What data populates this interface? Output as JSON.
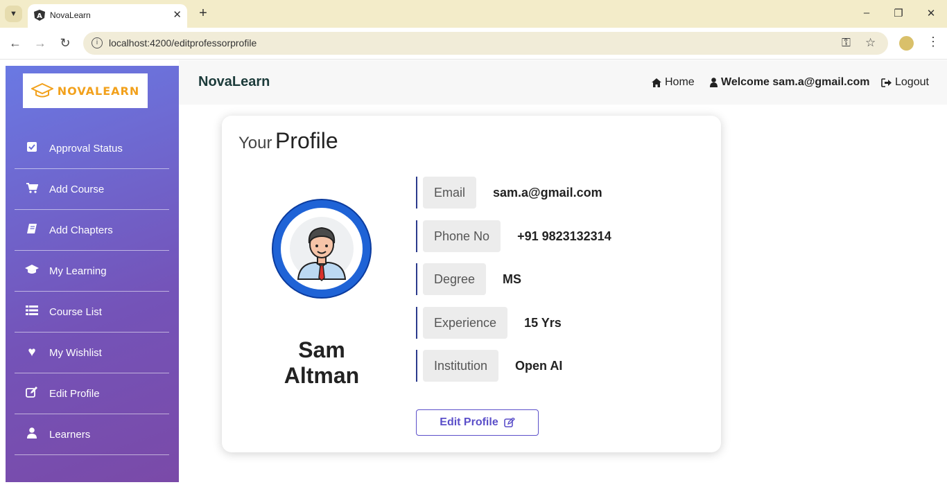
{
  "browser": {
    "tab_title": "NovaLearn",
    "url": "localhost:4200/editprofessorprofile"
  },
  "sidebar": {
    "logo_text": "NOVALEARN",
    "items": [
      {
        "label": "Approval Status",
        "icon": "check-square-icon"
      },
      {
        "label": "Add Course",
        "icon": "cart-icon"
      },
      {
        "label": "Add Chapters",
        "icon": "book-icon"
      },
      {
        "label": "My Learning",
        "icon": "graduation-cap-icon"
      },
      {
        "label": "Course List",
        "icon": "list-icon"
      },
      {
        "label": "My Wishlist",
        "icon": "heart-icon"
      },
      {
        "label": "Edit Profile",
        "icon": "edit-icon"
      },
      {
        "label": "Learners",
        "icon": "user-icon"
      }
    ]
  },
  "topnav": {
    "brand": "NovaLearn",
    "home_label": "Home",
    "welcome_label": "Welcome sam.a@gmail.com",
    "logout_label": "Logout"
  },
  "profile": {
    "title_small": "Your",
    "title_big": "Profile",
    "name": "Sam Altman",
    "fields": [
      {
        "label": "Email",
        "value": "sam.a@gmail.com"
      },
      {
        "label": "Phone No",
        "value": "+91 9823132314"
      },
      {
        "label": "Degree",
        "value": "MS"
      },
      {
        "label": "Experience",
        "value": "15 Yrs"
      },
      {
        "label": "Institution",
        "value": "Open AI"
      }
    ],
    "edit_button_label": "Edit Profile"
  },
  "colors": {
    "sidebar_top": "#6a79e3",
    "sidebar_bottom": "#7a4aa8",
    "accent": "#5b4fc9",
    "avatar_ring": "#1f63d6"
  }
}
